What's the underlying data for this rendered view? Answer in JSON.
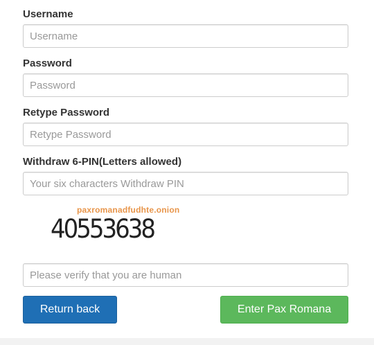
{
  "form": {
    "fields": [
      {
        "label": "Username",
        "placeholder": "Username"
      },
      {
        "label": "Password",
        "placeholder": "Password"
      },
      {
        "label": "Retype Password",
        "placeholder": "Retype Password"
      },
      {
        "label": "Withdraw 6-PIN(Letters allowed)",
        "placeholder": "Your six characters Withdraw PIN"
      }
    ]
  },
  "captcha": {
    "domain": "paxromanadfudhte.onion",
    "code": "40553638",
    "domain_color": "#e8954a"
  },
  "verify": {
    "placeholder": "Please verify that you are human"
  },
  "buttons": {
    "back_label": "Return back",
    "back_color": "#1f6fb5",
    "enter_label": "Enter Pax Romana",
    "enter_color": "#5cb85c"
  }
}
